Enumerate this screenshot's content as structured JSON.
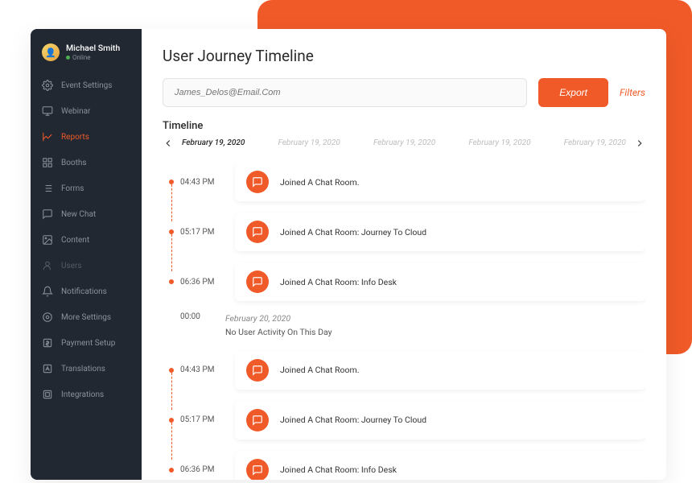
{
  "profile": {
    "name": "Michael Smith",
    "status": "Online"
  },
  "sidebar": {
    "items": [
      {
        "label": "Event Settings",
        "icon": "gear-icon"
      },
      {
        "label": "Webinar",
        "icon": "monitor-icon"
      },
      {
        "label": "Reports",
        "icon": "chart-icon",
        "active": true
      },
      {
        "label": "Booths",
        "icon": "grid-icon"
      },
      {
        "label": "Forms",
        "icon": "list-icon"
      },
      {
        "label": "New Chat",
        "icon": "chat-icon"
      },
      {
        "label": "Content",
        "icon": "image-icon"
      },
      {
        "label": "Users",
        "icon": "user-icon",
        "dim": true
      },
      {
        "label": "Notifications",
        "icon": "bell-icon"
      },
      {
        "label": "More Settings",
        "icon": "sliders-icon"
      },
      {
        "label": "Payment Setup",
        "icon": "dollar-icon"
      },
      {
        "label": "Translations",
        "icon": "font-icon"
      },
      {
        "label": "Integrations",
        "icon": "link-icon"
      }
    ]
  },
  "page": {
    "title": "User Journey Timeline"
  },
  "search": {
    "placeholder": "James_Delos@Email.Com"
  },
  "actions": {
    "export_label": "Export",
    "filters_label": "Filters"
  },
  "timeline": {
    "label": "Timeline",
    "dates": [
      "February 19, 2020",
      "February 19, 2020",
      "February 19, 2020",
      "February 19, 2020",
      "February 19, 2020"
    ],
    "active_date_index": 0,
    "events": [
      {
        "time": "04:43 PM",
        "text": "Joined A Chat Room."
      },
      {
        "time": "05:17 PM",
        "text": "Joined A Chat Room: Journey To Cloud"
      },
      {
        "time": "06:36 PM",
        "text": "Joined A Chat Room: Info Desk",
        "last_in_group": true
      }
    ],
    "gap": {
      "time": "00:00",
      "date": "February 20, 2020",
      "text": "No User Activity On This Day"
    },
    "events2": [
      {
        "time": "04:43 PM",
        "text": "Joined A Chat Room."
      },
      {
        "time": "05:17 PM",
        "text": "Joined A Chat Room: Journey To Cloud"
      },
      {
        "time": "06:36 PM",
        "text": "Joined A Chat Room: Info Desk",
        "last_in_group": true
      }
    ]
  },
  "colors": {
    "accent": "#f05a28",
    "sidebar_bg": "#212832"
  }
}
